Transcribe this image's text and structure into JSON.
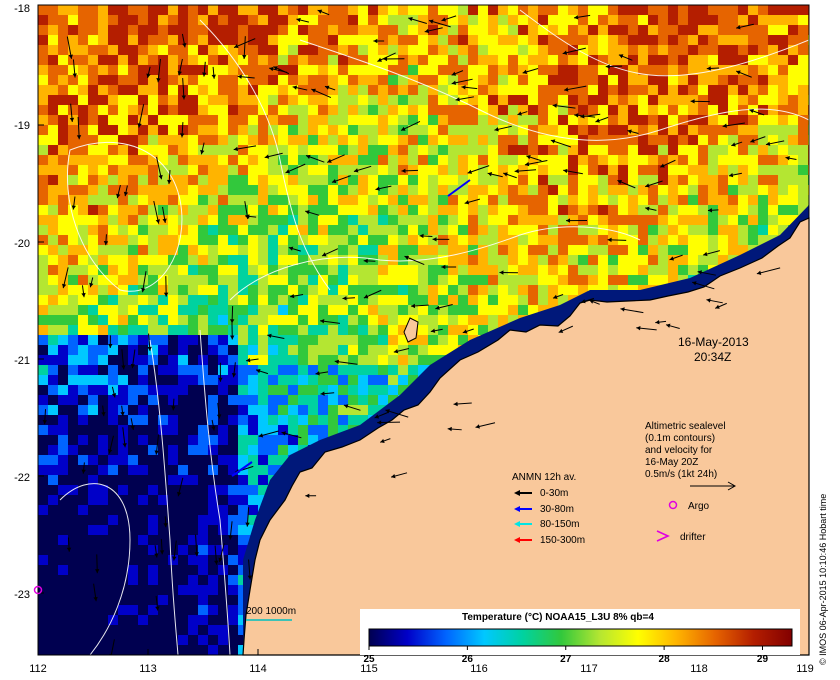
{
  "map": {
    "lon_ticks": [
      "112",
      "113",
      "114",
      "115",
      "116",
      "117",
      "118",
      "119"
    ],
    "lat_ticks": [
      "-18",
      "-19",
      "-20",
      "-21",
      "-22",
      "-23"
    ],
    "lon_range": [
      112,
      119
    ],
    "lat_range": [
      -23.6,
      -18
    ],
    "land_color": "#f9c89b",
    "coast_color": "#000000"
  },
  "annotation": {
    "date": "16-May-2013",
    "time": "20:34Z",
    "sealevel_lines": [
      "Altimetric sealevel",
      "(0.1m contours)",
      "and velocity for",
      "16-May 20Z",
      "0.5m/s (1kt 24h)"
    ]
  },
  "anmn_legend": {
    "title": "ANMN 12h av.",
    "items": [
      {
        "label": "0-30m",
        "color": "#000000"
      },
      {
        "label": "30-80m",
        "color": "#0000ff"
      },
      {
        "label": "80-150m",
        "color": "#00e5e5"
      },
      {
        "label": "150-300m",
        "color": "#ff0000"
      }
    ]
  },
  "markers": {
    "argo_label": "Argo",
    "argo_color": "#e000e0",
    "drifter_label": "drifter",
    "drifter_color": "#e000e0"
  },
  "scale": {
    "label": "200 1000m",
    "color": "#00c0c0"
  },
  "colorbar": {
    "title": "Temperature (°C) NOAA15_L3U 8% qb=4",
    "tick_labels": [
      "25",
      "26",
      "27",
      "28",
      "29"
    ],
    "range": [
      25,
      29.3
    ],
    "stops": [
      "#000050",
      "#0000c8",
      "#0064ff",
      "#00c8ff",
      "#00d2a0",
      "#32c83c",
      "#b4e632",
      "#ffff00",
      "#ffb400",
      "#e66400",
      "#b41e00",
      "#820000"
    ]
  },
  "credit": "© IMOS 06-Apr-2015 10:10:46 Hobart time"
}
